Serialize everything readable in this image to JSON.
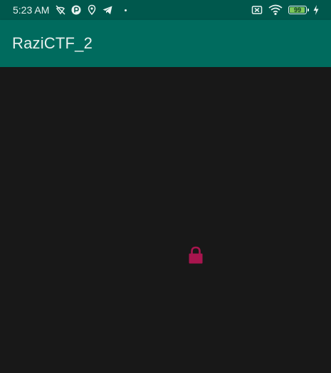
{
  "status_bar": {
    "time": "5:23 AM",
    "battery_level": "99",
    "battery_percent": 99,
    "icons": [
      "wifi-off-icon",
      "data-saver-icon",
      "location-icon",
      "telegram-icon",
      "notification-dot-icon",
      "sim-disabled-icon",
      "wifi-icon",
      "battery-icon",
      "charging-bolt-icon"
    ],
    "colors": {
      "background": "#00584d",
      "battery_fill": "#7cc75a"
    }
  },
  "app_bar": {
    "title": "RaziCTF_2",
    "background": "#006b5e"
  },
  "main": {
    "background": "#181818",
    "lock_icon_color": "#a8154e",
    "lock_icon": "lock-icon"
  }
}
